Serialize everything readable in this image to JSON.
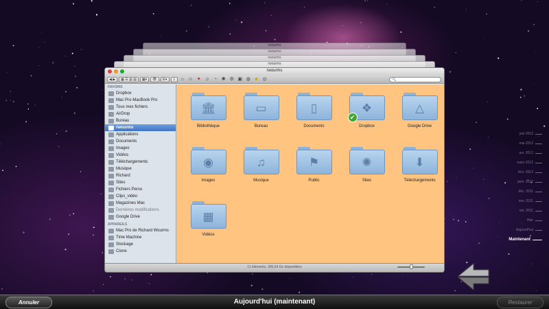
{
  "stack_window_titles": [
    "rwourms",
    "rwourms",
    "rwourms",
    "rwourms"
  ],
  "window": {
    "title": "rwourms",
    "search_placeholder": "",
    "status": "11 éléments, 306,54 Go disponibles"
  },
  "sidebar": {
    "favorites_header": "FAVORIS",
    "favorites": [
      {
        "label": "Dropbox",
        "icon": "dropbox-icon"
      },
      {
        "label": "Mac Pro-MacBook Pro",
        "icon": "computer-icon"
      },
      {
        "label": "Tous mes fichiers",
        "icon": "all-files-icon"
      },
      {
        "label": "AirDrop",
        "icon": "airdrop-icon"
      },
      {
        "label": "Bureau",
        "icon": "desktop-icon"
      },
      {
        "label": "rwourms",
        "icon": "home-icon",
        "selected": true
      },
      {
        "label": "Applications",
        "icon": "applications-icon"
      },
      {
        "label": "Documents",
        "icon": "documents-icon"
      },
      {
        "label": "Images",
        "icon": "images-icon"
      },
      {
        "label": "Vidéos",
        "icon": "videos-icon"
      },
      {
        "label": "Téléchargements",
        "icon": "downloads-icon"
      },
      {
        "label": "Musique",
        "icon": "music-icon"
      },
      {
        "label": "Richard",
        "icon": "folder-icon"
      },
      {
        "label": "Sites",
        "icon": "folder-icon"
      },
      {
        "label": "Fichiers Perso",
        "icon": "folder-icon"
      },
      {
        "label": "Clips_vidéo",
        "icon": "folder-icon"
      },
      {
        "label": "Magazines Mac",
        "icon": "folder-icon"
      },
      {
        "label": "Dernières modifications",
        "icon": "gear-icon",
        "dim": true
      },
      {
        "label": "Google Drive",
        "icon": "google-drive-icon"
      }
    ],
    "devices_header": "APPAREILS",
    "devices": [
      {
        "label": "Mac Pro de Richard Wourms",
        "icon": "computer-icon"
      },
      {
        "label": "Time Machine",
        "icon": "disk-icon"
      },
      {
        "label": "Stockage",
        "icon": "disk-icon"
      },
      {
        "label": "Clone",
        "icon": "disk-icon"
      }
    ]
  },
  "folders": [
    {
      "label": "Bibliothèque",
      "icon": "library-icon",
      "glyph": "🏛"
    },
    {
      "label": "Bureau",
      "icon": "desktop-icon",
      "glyph": "▭"
    },
    {
      "label": "Documents",
      "icon": "document-icon",
      "glyph": "▯"
    },
    {
      "label": "Dropbox",
      "icon": "dropbox-icon",
      "glyph": "❖",
      "badge": "✔"
    },
    {
      "label": "Google Drive",
      "icon": "google-drive-icon",
      "glyph": "△"
    },
    {
      "label": "Images",
      "icon": "camera-icon",
      "glyph": "◉"
    },
    {
      "label": "Musique",
      "icon": "music-note-icon",
      "glyph": "♫"
    },
    {
      "label": "Public",
      "icon": "public-icon",
      "glyph": "⚑"
    },
    {
      "label": "Sites",
      "icon": "compass-icon",
      "glyph": "✺"
    },
    {
      "label": "Téléchargements",
      "icon": "download-icon",
      "glyph": "⬇"
    },
    {
      "label": "Vidéos",
      "icon": "film-icon",
      "glyph": "▦"
    }
  ],
  "timeline": {
    "entries": [
      "juin 2012",
      "mai 2012",
      "avr. 2012",
      "mars 2012",
      "févr. 2012",
      "janv. 2012",
      "déc. 2011",
      "nov. 2011",
      "oct. 2011",
      "Hier",
      "Aujourd'hui"
    ],
    "now": "Maintenant"
  },
  "bottom_bar": {
    "cancel": "Annuler",
    "title": "Aujourd'hui (maintenant)",
    "restore": "Restaurer"
  },
  "colors": {
    "content_background": "#ffc480",
    "selection": "#3d74c5"
  }
}
